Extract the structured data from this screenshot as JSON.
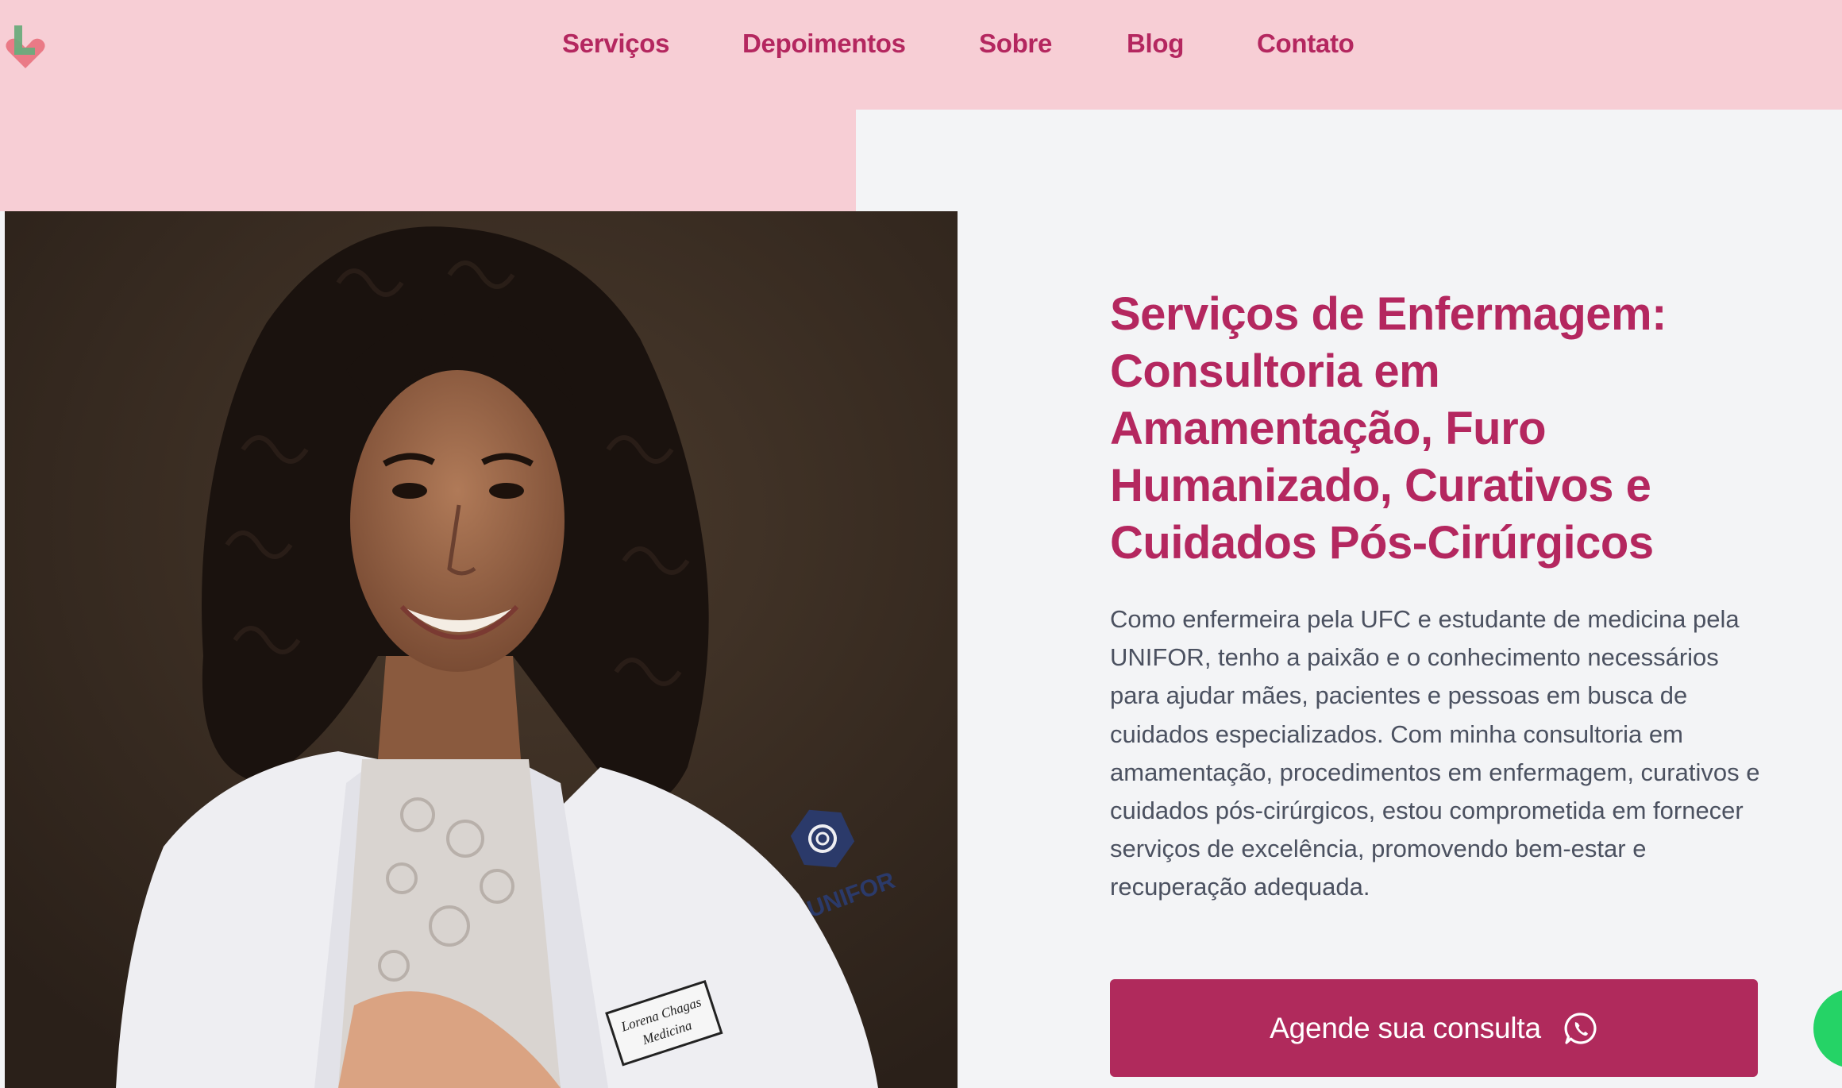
{
  "header": {
    "logo_name": "brand-logo",
    "nav": [
      {
        "label": "Serviços"
      },
      {
        "label": "Depoimentos"
      },
      {
        "label": "Sobre"
      },
      {
        "label": "Blog"
      },
      {
        "label": "Contato"
      }
    ]
  },
  "hero": {
    "headline": "Serviços de Enfermagem: Consultoria em Amamentação, Furo Humanizado, Curativos e Cuidados Pós-Cirúrgicos",
    "description": "Como enfermeira pela UFC e estudante de medicina pela UNIFOR, tenho a paixão e o conhecimento necessários para ajudar mães, pacientes e pessoas em busca de cuidados especializados. Com minha consultoria em amamentação, procedimentos em enfermagem, curativos e cuidados pós-cirúrgicos, estou comprometida em fornecer serviços de excelência, promovendo bem-estar e recuperação adequada.",
    "cta_label": "Agende sua consulta",
    "cta_icon": "whatsapp-icon"
  },
  "photo": {
    "coat_patch_text": "UNIFOR",
    "name_tag_line1": "Lorena Chagas",
    "name_tag_line2": "Medicina"
  },
  "floating_button": {
    "icon": "whatsapp-icon"
  },
  "colors": {
    "header_bg": "#f7ced5",
    "accent": "#b4275f",
    "cta_bg": "#b02a5c",
    "page_bg": "#f3f4f6",
    "body_text": "#4b5160",
    "whatsapp": "#25d366"
  }
}
